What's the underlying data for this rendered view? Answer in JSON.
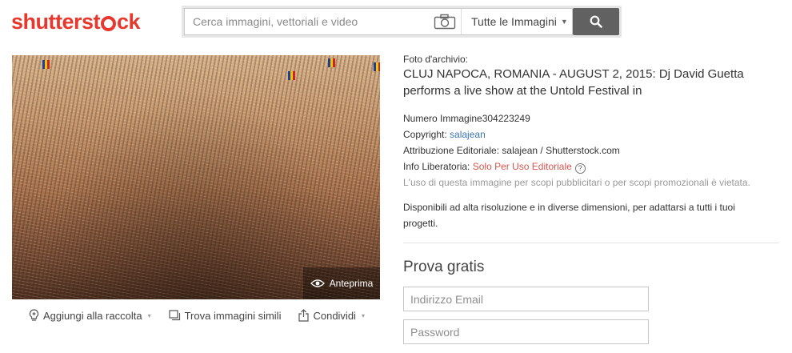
{
  "header": {
    "logo_text_a": "shutterst",
    "logo_text_b": "ck",
    "search_placeholder": "Cerca immagini, vettoriali e video",
    "search_type": "Tutte le Immagini",
    "icons": {
      "camera": "camera-icon",
      "search": "magnifier-icon"
    }
  },
  "photo": {
    "preview_label": "Anteprima",
    "actions": [
      {
        "label": "Aggiungi alla raccolta",
        "icon": "lightbulb-icon",
        "caret": "▾"
      },
      {
        "label": "Trova immagini simili",
        "icon": "similar-images-icon"
      },
      {
        "label": "Condividi",
        "icon": "share-icon",
        "caret": "▾"
      }
    ]
  },
  "details": {
    "kind": "Foto d'archivio:",
    "title": "CLUJ NAPOCA, ROMANIA - AUGUST 2, 2015: Dj David Guetta performs a live show at the Untold Festival in",
    "image_number_label": "Numero Immagine",
    "image_number": "304223249",
    "copyright_label": "Copyright:",
    "copyright_value": "salajean",
    "attribution": "Attribuzione Editoriale: salajean / Shutterstock.com",
    "release_label": "Info Liberatoria:",
    "release_value": "Solo Per Uso Editoriale",
    "warning": "L'uso di questa immagine per scopi pubblicitari o per scopi promozionali è vietata.",
    "availability": "Disponibili ad alta risoluzione e in diverse dimensioni, per adattarsi a tutti i tuoi progetti."
  },
  "trial": {
    "title": "Prova gratis",
    "email_placeholder": "Indirizzo Email",
    "password_placeholder": "Password"
  },
  "colors": {
    "brand": "#e8372c",
    "link": "#3d73b4",
    "editorial": "#d9534f"
  }
}
